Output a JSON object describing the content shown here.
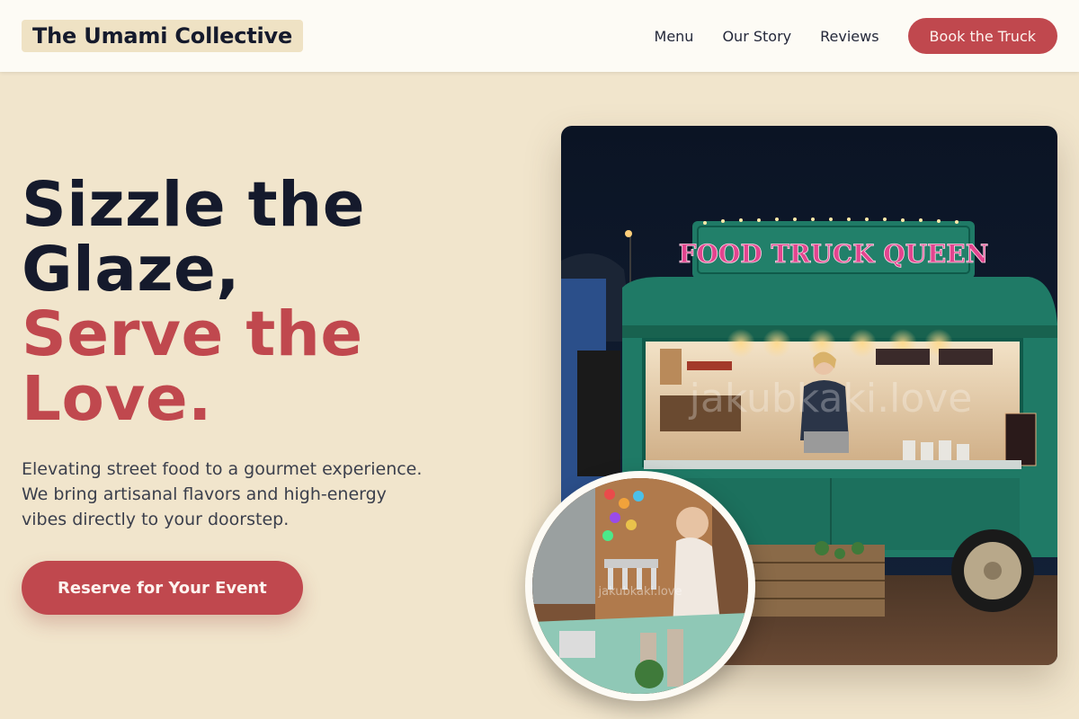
{
  "brand": {
    "name": "The Umami Collective"
  },
  "nav": {
    "links": [
      {
        "label": "Menu"
      },
      {
        "label": "Our Story"
      },
      {
        "label": "Reviews"
      }
    ],
    "cta_label": "Book the Truck"
  },
  "hero": {
    "title_line1": "Sizzle the",
    "title_line2": "Glaze,",
    "title_line3": "Serve the",
    "title_line4": "Love.",
    "subtitle": "Elevating street food to a gourmet experience. We bring artisanal flavors and high-energy vibes directly to your doorstep.",
    "cta_label": "Reserve for Your Event"
  },
  "images": {
    "main_sign_text": "FOOD TRUCK QUEEN",
    "watermark": "jakubkaki.love",
    "inset_watermark": "jakubkaki.love"
  },
  "colors": {
    "accent": "#c0484e",
    "background": "#f1e5cc",
    "header_bg": "#fdfbf5",
    "text_dark": "#151a2c",
    "truck_green": "#1f7a66"
  }
}
